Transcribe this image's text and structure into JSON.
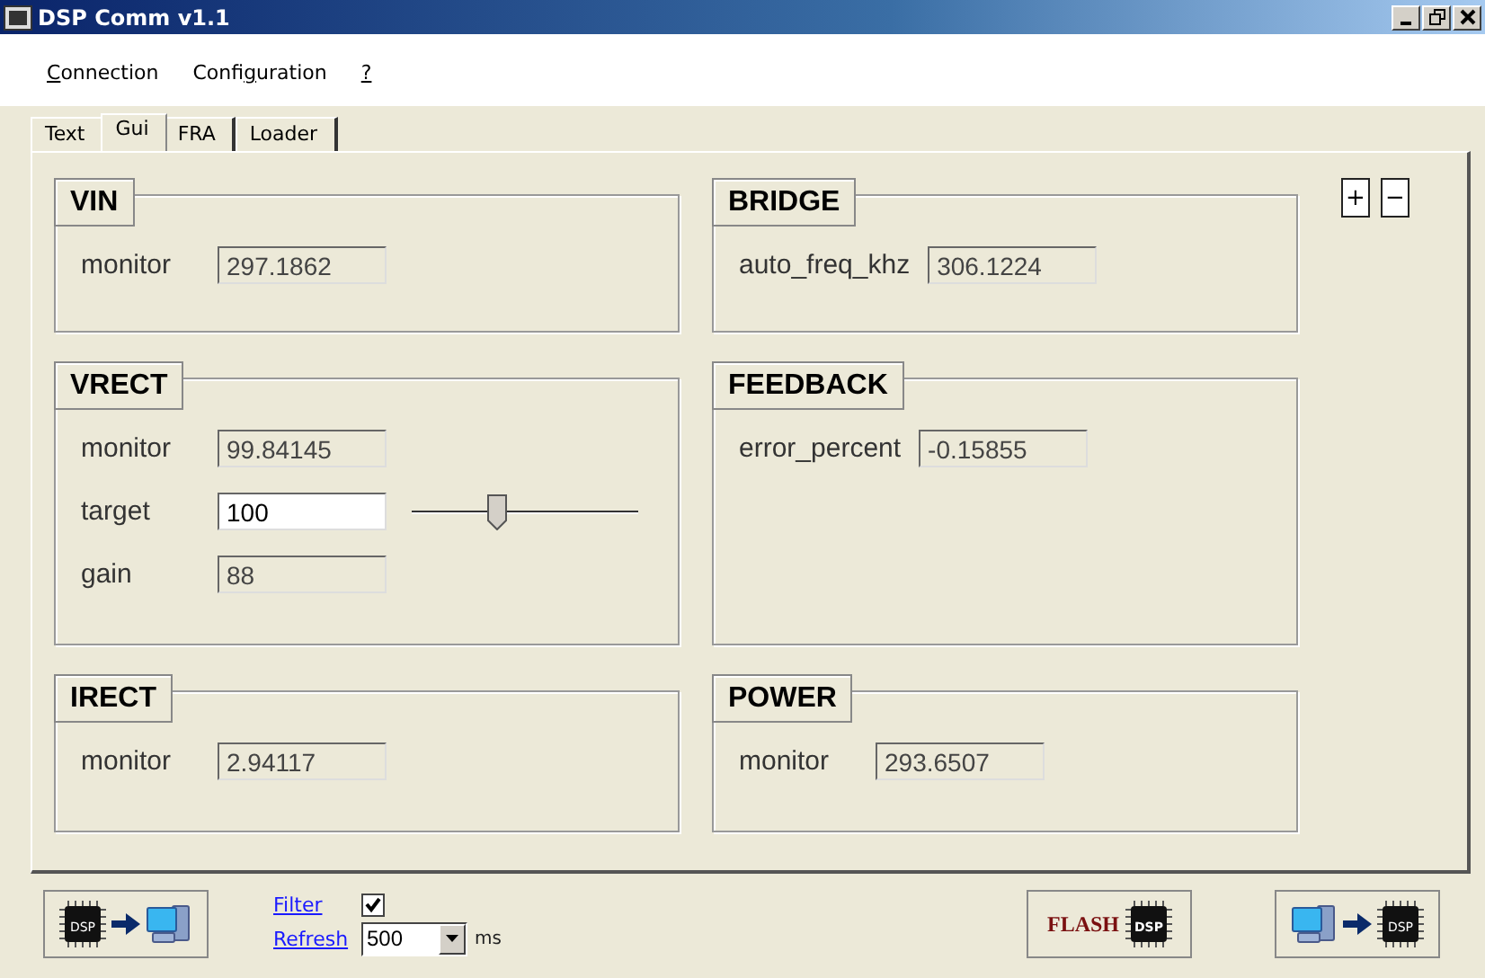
{
  "window": {
    "title": "DSP Comm v1.1"
  },
  "menu": [
    {
      "accel": "C",
      "after": "onnection"
    },
    {
      "before": "Confi",
      "accel": "g",
      "after": "uration"
    },
    {
      "accel": "?"
    }
  ],
  "tabs": [
    {
      "label": "Text",
      "selected": false
    },
    {
      "label": "Gui",
      "selected": true
    },
    {
      "label": "FRA",
      "selected": false
    },
    {
      "label": "Loader",
      "selected": false
    }
  ],
  "zoom_buttons": [
    "+",
    "−"
  ],
  "groups": [
    {
      "title": "VIN",
      "fields": [
        {
          "label": "monitor",
          "value": "297.1862",
          "editable": false
        }
      ]
    },
    {
      "title": "BRIDGE",
      "fields": [
        {
          "label": "auto_freq_khz",
          "value": "306.1224",
          "editable": false
        }
      ]
    },
    {
      "title": "VRECT",
      "fields": [
        {
          "label": "monitor",
          "value": "99.84145",
          "editable": false
        },
        {
          "label": "target",
          "value": "100",
          "editable": true,
          "level": 0.37
        },
        {
          "label": "gain",
          "value": "88",
          "editable": false
        }
      ]
    },
    {
      "title": "FEEDBACK",
      "fields": [
        {
          "label": "error_percent",
          "value": "-0.15855",
          "editable": false
        }
      ]
    },
    {
      "title": "IRECT",
      "fields": [
        {
          "label": "monitor",
          "value": "2.94117",
          "editable": false
        }
      ]
    },
    {
      "title": "POWER",
      "fields": [
        {
          "label": "monitor",
          "value": "293.6507",
          "editable": false
        }
      ]
    }
  ],
  "bottom": {
    "buttons": [
      {
        "kind": "dsp-to-pc",
        "chip": "DSP"
      },
      {
        "kind": "flash",
        "label": "FLASH",
        "chip": "DSP"
      },
      {
        "kind": "pc-to-dsp",
        "chip": "DSP"
      }
    ],
    "filter": {
      "label": "Filter",
      "checked": true
    },
    "refresh": {
      "label": "Refresh",
      "value": "500",
      "unit": "ms"
    }
  }
}
